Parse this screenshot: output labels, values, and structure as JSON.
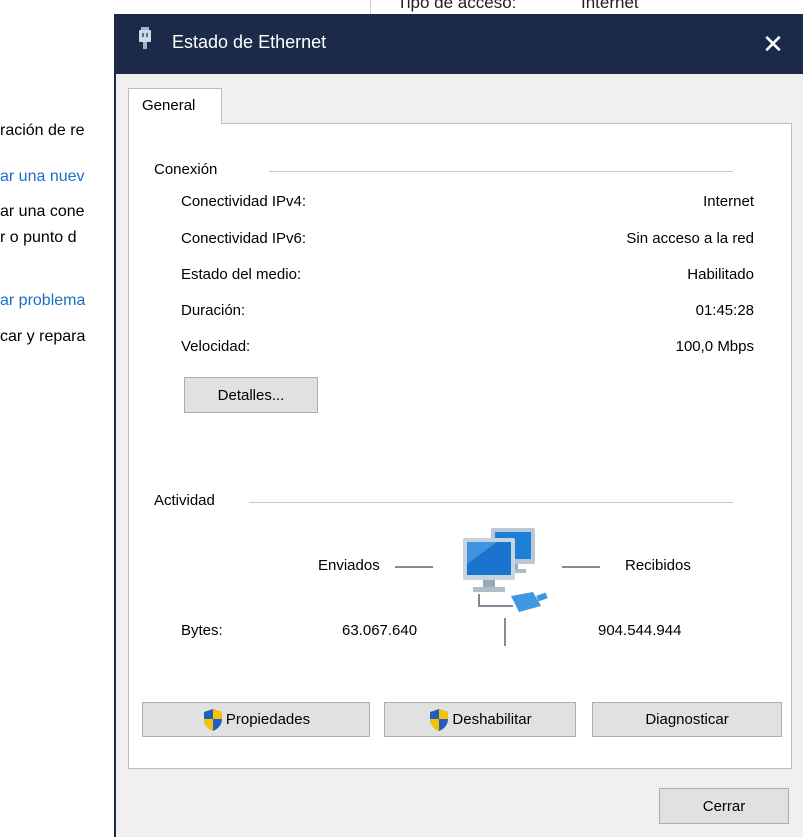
{
  "background": {
    "top_texts": [
      "Tipo de acceso:",
      "Internet"
    ],
    "left_lines": [
      {
        "text": "ración de re",
        "link": false
      },
      {
        "text": "ar una nuev",
        "link": true
      },
      {
        "text": "ar una cone",
        "link": false
      },
      {
        "text": "r o punto d",
        "link": false
      },
      {
        "text": "ar problema",
        "link": true
      },
      {
        "text": "car y repara",
        "link": false
      }
    ]
  },
  "dialog": {
    "title": "Estado de Ethernet",
    "close_glyph": "✕",
    "tab_label": "General",
    "connection": {
      "title": "Conexión",
      "rows": [
        {
          "label": "Conectividad IPv4:",
          "value": "Internet"
        },
        {
          "label": "Conectividad IPv6:",
          "value": "Sin acceso a la red"
        },
        {
          "label": "Estado del medio:",
          "value": "Habilitado"
        },
        {
          "label": "Duración:",
          "value": "01:45:28"
        },
        {
          "label": "Velocidad:",
          "value": "100,0 Mbps"
        }
      ],
      "details_button": "Detalles..."
    },
    "activity": {
      "title": "Actividad",
      "sent_label": "Enviados",
      "received_label": "Recibidos",
      "bytes_label": "Bytes:",
      "bytes_sent": "63.067.640",
      "bytes_received": "904.544.944",
      "icon": "network-computers-icon"
    },
    "buttons": {
      "properties": "Propiedades",
      "disable": "Deshabilitar",
      "diagnose": "Diagnosticar"
    },
    "close_button": "Cerrar",
    "colors": {
      "titlebar": "#1b2a48",
      "link": "#1a6fc9",
      "button_face": "#e1e1e1",
      "panel": "#ffffff",
      "dialog_bg": "#f0f0f0"
    }
  }
}
